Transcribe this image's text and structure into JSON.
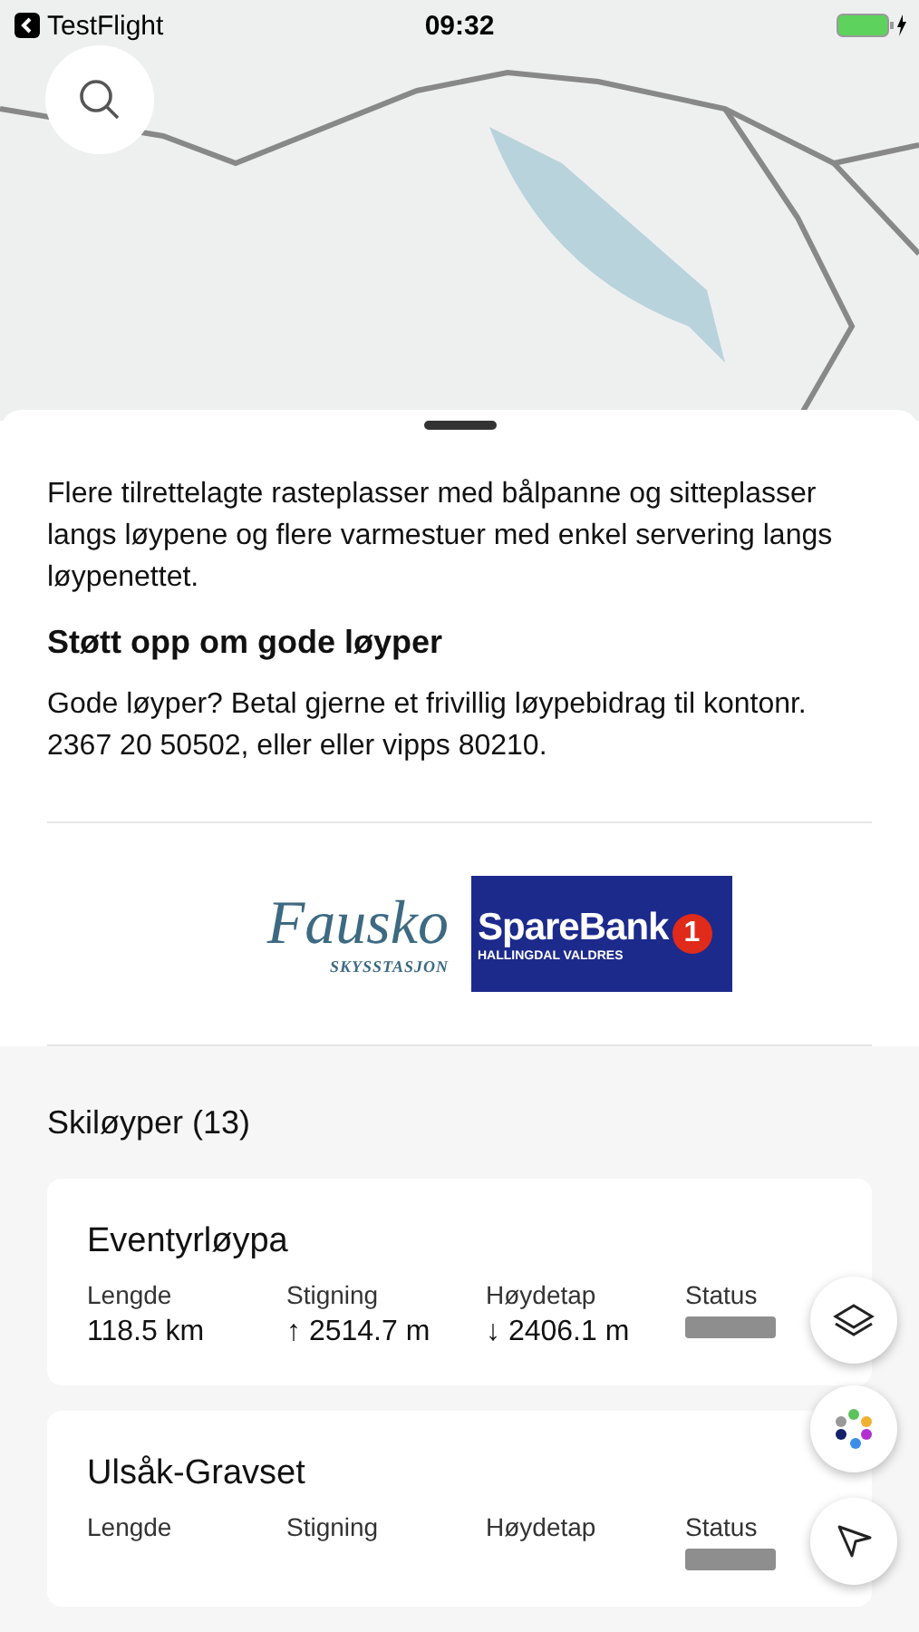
{
  "status_bar": {
    "back_label": "TestFlight",
    "time": "09:32"
  },
  "sheet": {
    "intro": "Flere tilrettelagte rasteplasser med bålpanne og sitteplasser langs løypene og flere varmestuer med enkel servering langs løypenettet.",
    "support_heading": "Støtt opp om gode løyper",
    "support_text": "Gode løyper? Betal gjerne et frivillig løypebidrag til kontonr. 2367 20 50502, eller eller vipps 80210.",
    "sponsors": [
      {
        "kind": "script",
        "name": "Fausko",
        "tagline": "SKYSSTASJON"
      },
      {
        "kind": "bank",
        "name": "SpareBank",
        "tagline": "HALLINGDAL VALDRES",
        "badge": "1"
      }
    ],
    "trails_heading": "Skiløyper (13)",
    "trails": [
      {
        "name": "Eventyrløypa",
        "stats": [
          {
            "label": "Lengde",
            "value": "118.5 km"
          },
          {
            "label": "Stigning",
            "value": "↑ 2514.7 m"
          },
          {
            "label": "Høydetap",
            "value": "↓ 2406.1 m"
          }
        ],
        "status_label": "Status",
        "color": "#8e8e8e"
      },
      {
        "name": "Ulsåk-Gravset",
        "stats": [
          {
            "label": "Lengde"
          },
          {
            "label": "Stigning"
          },
          {
            "label": "Høydetap"
          }
        ],
        "status_label": "Status",
        "color": "#8e8e8e"
      }
    ]
  }
}
